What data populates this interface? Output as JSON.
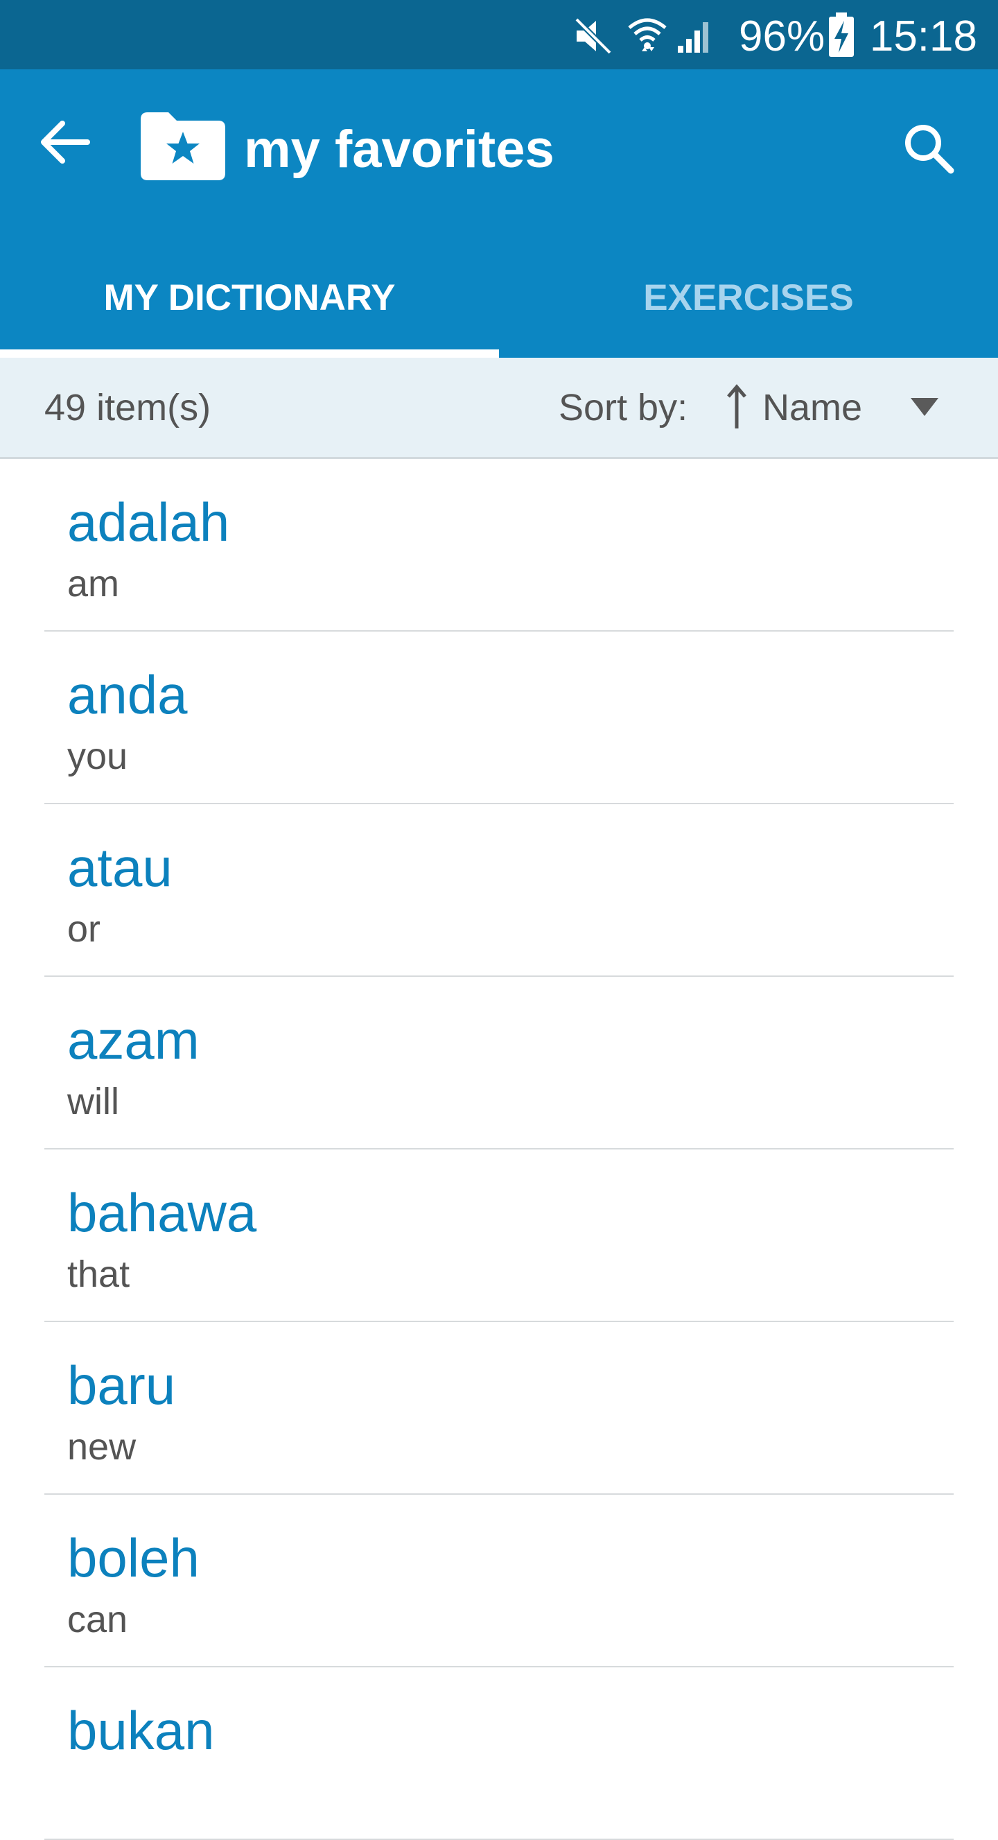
{
  "status_bar": {
    "battery_percent": "96%",
    "time": "15:18",
    "icons": [
      "mute-icon",
      "wifi-icon",
      "signal-icon",
      "battery-charging-icon"
    ]
  },
  "app_bar": {
    "title": "my favorites",
    "back_icon": "arrow-left-icon",
    "folder_icon": "folder-star-icon",
    "search_icon": "search-icon"
  },
  "tabs": [
    {
      "label": "MY DICTIONARY",
      "selected": true
    },
    {
      "label": "EXERCISES",
      "selected": false
    }
  ],
  "sort_bar": {
    "item_count": "49 item(s)",
    "sort_label": "Sort by:",
    "sort_value": "Name",
    "sort_direction_icon": "arrow-up-icon",
    "dropdown_icon": "triangle-down-icon"
  },
  "words": [
    {
      "word": "adalah",
      "translation": "am"
    },
    {
      "word": "anda",
      "translation": "you"
    },
    {
      "word": "atau",
      "translation": "or"
    },
    {
      "word": "azam",
      "translation": "will"
    },
    {
      "word": "bahawa",
      "translation": "that"
    },
    {
      "word": "baru",
      "translation": "new"
    },
    {
      "word": "boleh",
      "translation": "can"
    },
    {
      "word": "bukan",
      "translation": ""
    }
  ],
  "colors": {
    "status_bar": "#0b6691",
    "app_bar": "#0c86c2",
    "accent_text": "#0c81bd",
    "sort_bar_bg": "#e7f1f6",
    "inactive_tab": "#a7d4ee"
  }
}
